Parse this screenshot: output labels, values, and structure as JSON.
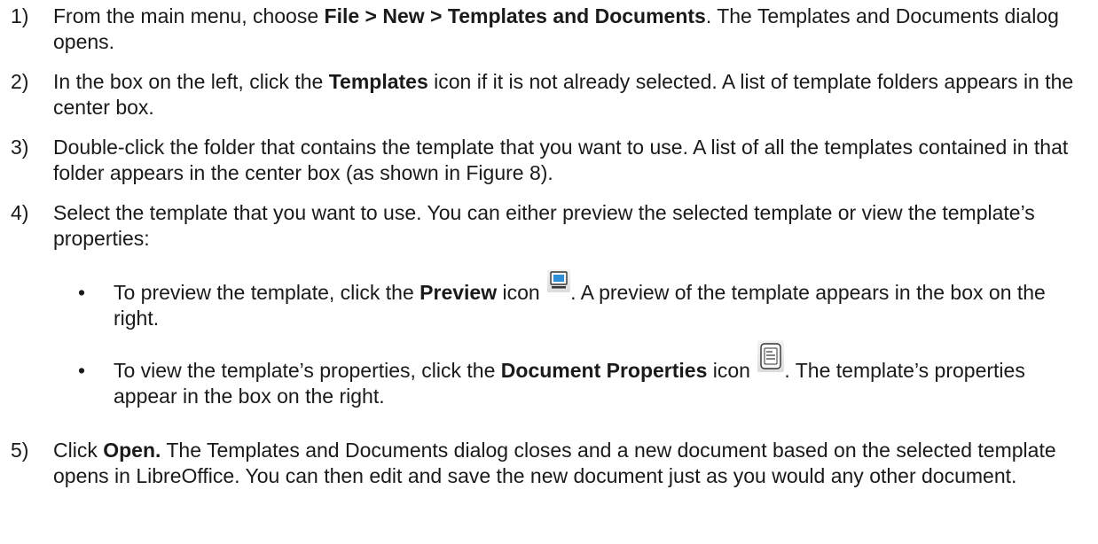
{
  "steps": [
    {
      "num": "1)",
      "a": "From the main menu, choose ",
      "b": "File > New > Templates and Documents",
      "c": ". The Templates and Documents dialog opens."
    },
    {
      "num": "2)",
      "a": "In the box on the left, click the ",
      "b": "Templates",
      "c": " icon if it is not already selected. A list of template folders appears in the center box."
    },
    {
      "num": "3)",
      "a": "Double-click the folder that contains the template that you want to use. A list of all the templates contained in that folder appears in the center box (as shown in Figure 8)."
    },
    {
      "num": "4)",
      "a": "Select the template that you want to use. You can either preview the selected template or view the template’s properties:"
    },
    {
      "num": "5)",
      "a": "Click ",
      "b": "Open.",
      "c": " The Templates and Documents dialog closes and a new document based on the selected template opens in LibreOffice. You can then edit and save the new document just as you would any other document."
    }
  ],
  "bullets": [
    {
      "dot": "•",
      "a": "To preview the template, click the ",
      "b": "Preview",
      "c": " icon ",
      "d": ". A preview of the template appears in the box on the right.",
      "icon": "preview-icon"
    },
    {
      "dot": "•",
      "a": "To view the template’s properties, click the ",
      "b": "Document Properties",
      "c": " icon ",
      "d": ". The template’s properties appear in the box on the right.",
      "icon": "document-properties-icon"
    }
  ]
}
